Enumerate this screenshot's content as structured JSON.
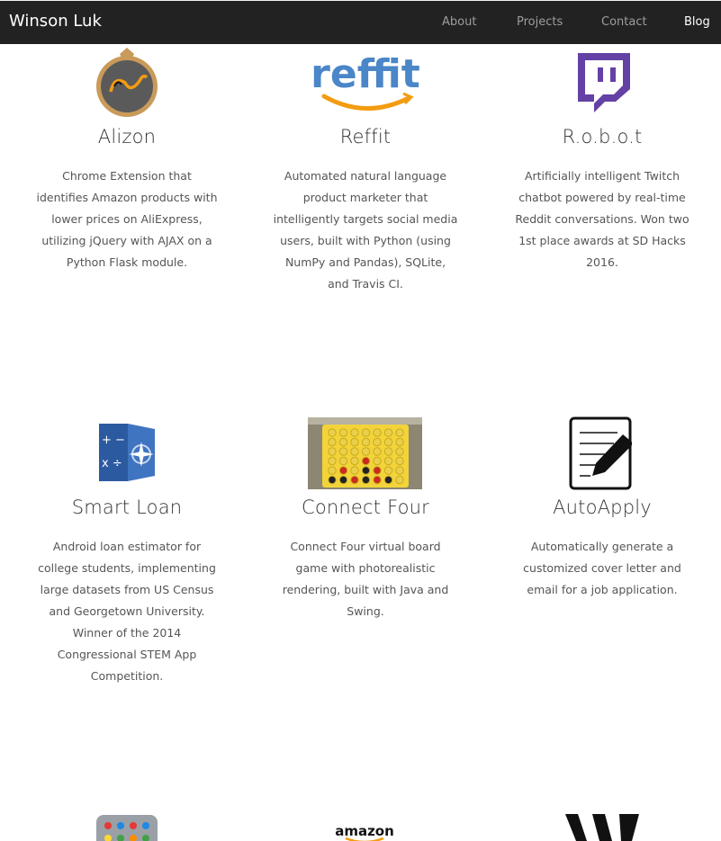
{
  "navbar": {
    "brand": "Winson Luk",
    "links": [
      {
        "label": "About",
        "active": false
      },
      {
        "label": "Projects",
        "active": false
      },
      {
        "label": "Contact",
        "active": false
      },
      {
        "label": "Blog",
        "active": true
      }
    ]
  },
  "projects": [
    {
      "title": "Alizon",
      "description": "Chrome Extension that identifies Amazon products with lower prices on AliExpress, utilizing jQuery with AJAX on a Python Flask module.",
      "icon": "alizon-logo-icon"
    },
    {
      "title": "Reffit",
      "description": "Automated natural language product marketer that intelligently targets social media users, built with Python (using NumPy and Pandas), SQLite, and Travis CI.",
      "icon": "reffit-logo-icon",
      "logo_text": "reffit"
    },
    {
      "title": "R.o.b.o.t",
      "description": "Artificially intelligent Twitch chatbot powered by real-time Reddit conversations. Won two 1st place awards at SD Hacks 2016.",
      "icon": "twitch-logo-icon"
    },
    {
      "title": "Smart Loan",
      "description": "Android loan estimator for college students, implementing large datasets from US Census and Georgetown University. Winner of the 2014 Congressional STEM App Competition.",
      "icon": "calculator-compass-icon"
    },
    {
      "title": "Connect Four",
      "description": "Connect Four virtual board game with photorealistic rendering, built with Java and Swing.",
      "icon": "connect-four-board-icon"
    },
    {
      "title": "AutoApply",
      "description": "Automatically generate a customized cover letter and email for a job application.",
      "icon": "document-pencil-icon"
    }
  ],
  "partial_row": [
    {
      "icon": "app-grid-icon"
    },
    {
      "icon": "amazon-logo-icon",
      "logo_text": "amazon"
    },
    {
      "icon": "w-logo-icon",
      "logo_text": "W"
    }
  ],
  "colors": {
    "navbar_bg": "#222222",
    "nav_link": "#9d9d9d",
    "nav_active": "#ffffff",
    "twitch": "#6441a5",
    "reffit_blue": "#4a86c8",
    "amazon_orange": "#f39c12"
  }
}
